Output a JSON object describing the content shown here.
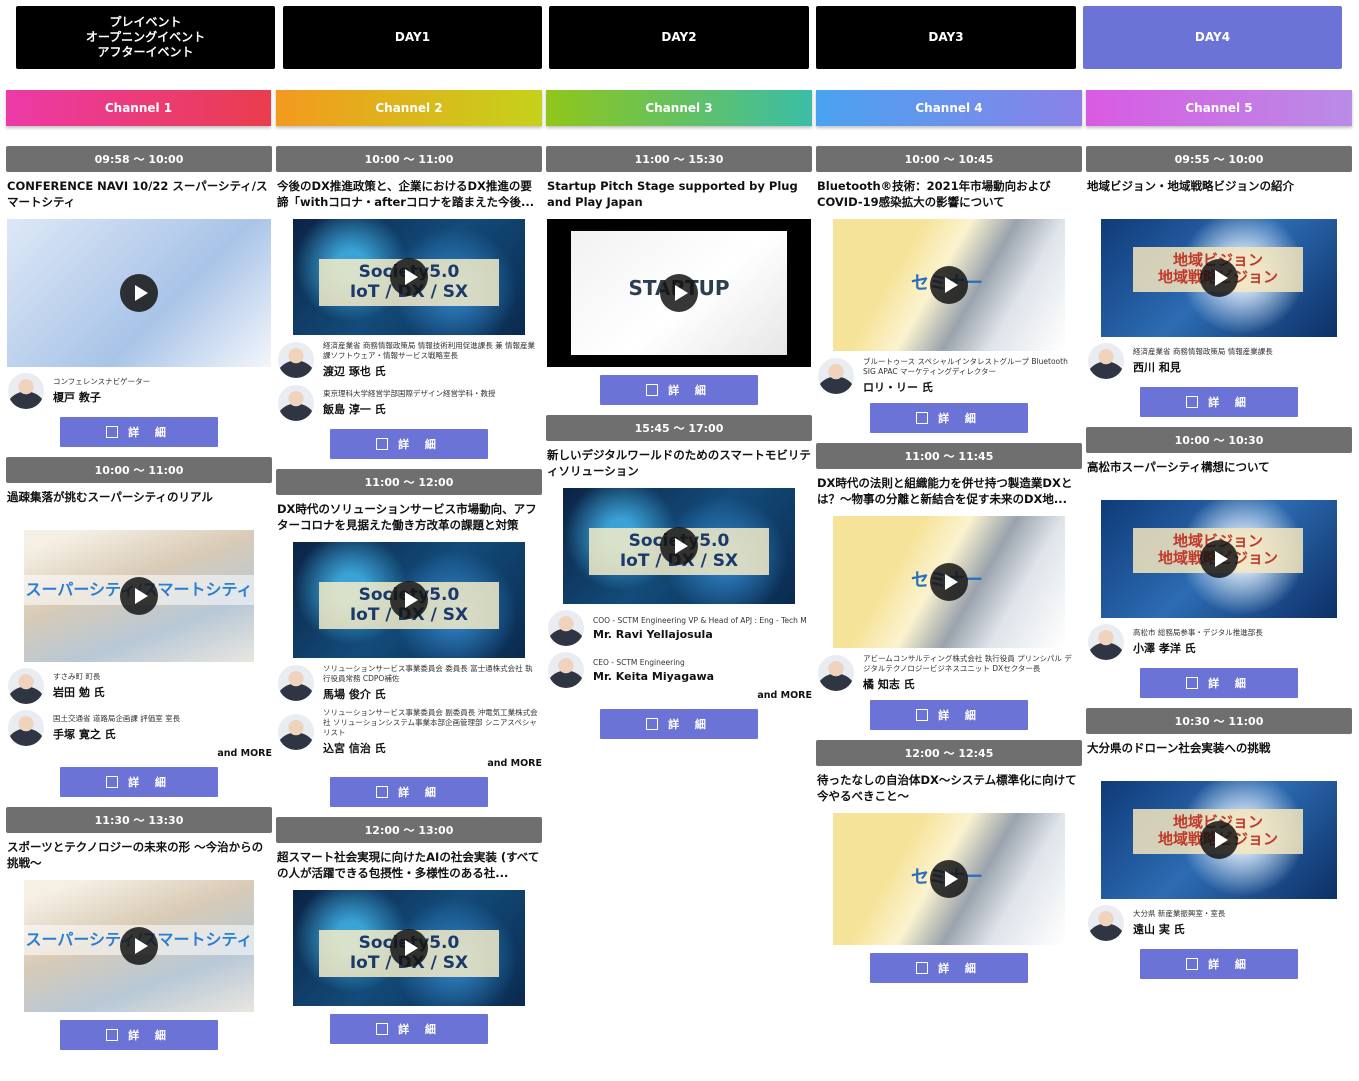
{
  "day_tabs": [
    {
      "label": "プレイベント\nオープニングイベント\nアフターイベント"
    },
    {
      "label": "DAY1"
    },
    {
      "label": "DAY2"
    },
    {
      "label": "DAY3"
    },
    {
      "label": "DAY4"
    }
  ],
  "channels": [
    {
      "label": "Channel 1",
      "colors": [
        "#ec3aa8",
        "#ea3d4c"
      ]
    },
    {
      "label": "Channel 2",
      "colors": [
        "#f39a1e",
        "#c5d21a"
      ]
    },
    {
      "label": "Channel 3",
      "colors": [
        "#8fc61a",
        "#3bbda7"
      ]
    },
    {
      "label": "Channel 4",
      "colors": [
        "#4aa3f0",
        "#8a82e8"
      ]
    },
    {
      "label": "Channel 5",
      "colors": [
        "#d95be3",
        "#b98ce6"
      ]
    }
  ],
  "detail_label": "詳 細",
  "columns": [
    {
      "sessions": [
        {
          "time": "09:58 ～ 10:00",
          "title": "CONFERENCE NAVI 10/22 スーパーシティ/スマートシティ",
          "thumb": "navi",
          "speakers": [
            {
              "aff": "コンフェレンスナビゲーター",
              "name": "榎戸 教子"
            }
          ]
        },
        {
          "time": "10:00 ～ 11:00",
          "title": "過疎集落が挑むスーパーシティのリアル",
          "thumb": "city",
          "thumb_text": "スーパーシティ/スマートシティ",
          "speakers": [
            {
              "aff": "すさみ町 町長",
              "name": "岩田 勉 氏"
            },
            {
              "aff": "国土交通省 道路局企画課 評価室 室長",
              "name": "手塚 寛之 氏"
            }
          ],
          "more": "and MORE"
        },
        {
          "time": "11:30 ～ 13:30",
          "title": "スポーツとテクノロジーの未来の形 ～今治からの挑戦～",
          "thumb": "city",
          "thumb_text": "スーパーシティ/スマートシティ",
          "speakers": []
        }
      ]
    },
    {
      "sessions": [
        {
          "time": "10:00 ～ 11:00",
          "title": "今後のDX推進政策と、企業におけるDX推進の要諦「withコロナ・afterコロナを踏まえた今後...",
          "thumb": "society",
          "thumb_text": "Society5.0\nIoT / DX / SX",
          "speakers": [
            {
              "aff": "経済産業省 商務情報政策局 情報技術利用促進課長 兼 情報産業課ソフトウェア・情報サービス戦略室長",
              "name": "渡辺 琢也 氏"
            },
            {
              "aff": "東京理科大学経営学部国際デザイン経営学科・教授",
              "name": "飯島 淳一 氏"
            }
          ]
        },
        {
          "time": "11:00 ～ 12:00",
          "title": "DX時代のソリューションサービス市場動向、アフターコロナを見据えた働き方改革の課題と対策",
          "thumb": "society",
          "thumb_text": "Society5.0\nIoT / DX / SX",
          "speakers": [
            {
              "aff": "ソリューションサービス事業委員会 委員長 富士通株式会社 執行役員常務 CDPO補佐",
              "name": "馬場 俊介 氏"
            },
            {
              "aff": "ソリューションサービス事業委員会 副委員長 沖電気工業株式会社 ソリューションシステム事業本部企画管理部 シニアスペシャリスト",
              "name": "込宮 信治 氏"
            }
          ],
          "more": "and MORE"
        },
        {
          "time": "12:00 ～ 13:00",
          "title": "超スマート社会実現に向けたAIの社会実装 (すべての人が活躍できる包摂性・多様性のある社...",
          "thumb": "society",
          "thumb_text": "Society5.0\nIoT / DX / SX",
          "speakers": []
        }
      ]
    },
    {
      "sessions": [
        {
          "time": "11:00 ～ 15:30",
          "title": "Startup Pitch Stage supported by Plug and Play Japan",
          "thumb": "startup",
          "thumb_text": "STARTUP",
          "speakers": []
        },
        {
          "time": "15:45 ～ 17:00",
          "title": "新しいデジタルワールドのためのスマートモビリティソリューション",
          "thumb": "society",
          "thumb_text": "Society5.0\nIoT / DX / SX",
          "speakers": [
            {
              "aff": "COO - SCTM Engineering VP & Head of APJ : Eng - Tech M",
              "name": "Mr. Ravi Yellajosula"
            },
            {
              "aff": "CEO - SCTM Engineering",
              "name": "Mr. Keita Miyagawa"
            }
          ],
          "more": "and MORE"
        }
      ]
    },
    {
      "sessions": [
        {
          "time": "10:00 ～ 10:45",
          "title": "Bluetooth®技術：2021年市場動向およびCOVID-19感染拡大の影響について",
          "thumb": "laptop",
          "thumb_text": "セミナー",
          "speakers": [
            {
              "aff": "ブルートゥース スペシャルインタレストグループ Bluetooth SIG APAC マーケティングディレクター",
              "name": "ロリ・リー 氏"
            }
          ]
        },
        {
          "time": "11:00 ～ 11:45",
          "title": "DX時代の法則と組織能力を併せ持つ製造業DXとは？～物事の分離と新結合を促す未来のDX地...",
          "thumb": "laptop",
          "thumb_text": "セミナー",
          "speakers": [
            {
              "aff": "アビームコンサルティング株式会社 執行役員 プリンシパル デジタルテクノロジービジネスユニット DXセクター長",
              "name": "橘 知志 氏"
            }
          ]
        },
        {
          "time": "12:00 ～ 12:45",
          "title": "待ったなしの自治体DX～システム標準化に向けて今やるべきこと～",
          "thumb": "laptop",
          "thumb_text": "セミナー",
          "speakers": []
        }
      ]
    },
    {
      "sessions": [
        {
          "time": "09:55 ～ 10:00",
          "title": "地域ビジョン・地域戦略ビジョンの紹介",
          "thumb": "japan",
          "thumb_text": "地域ビジョン\n地域戦略ビジョン",
          "speakers": [
            {
              "aff": "経済産業省 商務情報政策局 情報産業課長",
              "name": "西川 和見"
            }
          ]
        },
        {
          "time": "10:00 ～ 10:30",
          "title": "高松市スーパーシティ構想について",
          "thumb": "japan",
          "thumb_text": "地域ビジョン\n地域戦略ビジョン",
          "speakers": [
            {
              "aff": "高松市 総務局参事・デジタル推進部長",
              "name": "小澤 孝洋 氏"
            }
          ]
        },
        {
          "time": "10:30 ～ 11:00",
          "title": "大分県のドローン社会実装への挑戦",
          "thumb": "japan",
          "thumb_text": "地域ビジョン\n地域戦略ビジョン",
          "speakers": [
            {
              "aff": "大分県 新産業振興室・室長",
              "name": "遠山 実 氏"
            }
          ]
        }
      ]
    }
  ]
}
